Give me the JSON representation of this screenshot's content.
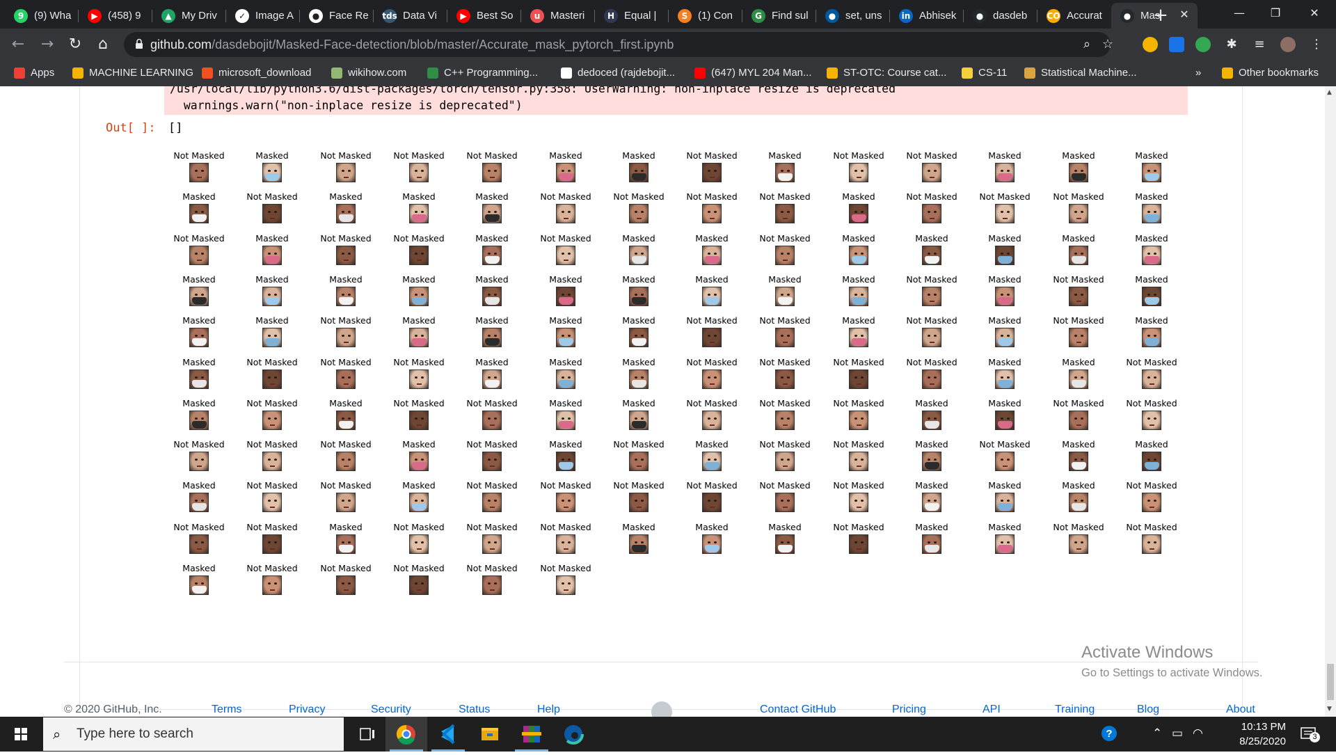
{
  "browser": {
    "tabs": [
      {
        "label": "(9) Wha",
        "icon": "whatsapp-icon",
        "color": "#25d366",
        "glyph": "9"
      },
      {
        "label": "(458) 9",
        "icon": "youtube-icon",
        "color": "#ff0000",
        "glyph": "▶"
      },
      {
        "label": "My Driv",
        "icon": "google-drive-icon",
        "color": "#1fa463",
        "glyph": "▲"
      },
      {
        "label": "Image A",
        "icon": "document-icon",
        "color": "#ffffff",
        "glyph": "✓"
      },
      {
        "label": "Face Re",
        "icon": "github-icon",
        "color": "#ffffff",
        "glyph": "●"
      },
      {
        "label": "Data Vi",
        "icon": "tds-icon",
        "color": "#355876",
        "glyph": "tds"
      },
      {
        "label": "Best So",
        "icon": "youtube-icon",
        "color": "#ff0000",
        "glyph": "▶"
      },
      {
        "label": "Masteri",
        "icon": "udemy-icon",
        "color": "#ec5252",
        "glyph": "u"
      },
      {
        "label": "Equal |",
        "icon": "hackerearth-icon",
        "color": "#323754",
        "glyph": "H"
      },
      {
        "label": "(1) Con",
        "icon": "stackoverflow-icon",
        "color": "#f48024",
        "glyph": "S"
      },
      {
        "label": "Find sul",
        "icon": "geeksforgeeks-icon",
        "color": "#2f8d46",
        "glyph": "G"
      },
      {
        "label": "set, uns",
        "icon": "cplusplus-icon",
        "color": "#00599c",
        "glyph": "●"
      },
      {
        "label": "Abhisek",
        "icon": "linkedin-icon",
        "color": "#0a66c2",
        "glyph": "in"
      },
      {
        "label": "dasdeb",
        "icon": "github-icon",
        "color": "#24292e",
        "glyph": "●"
      },
      {
        "label": "Accurat",
        "icon": "colab-icon",
        "color": "#f9ab00",
        "glyph": "CO"
      },
      {
        "label": "Mas",
        "icon": "github-icon",
        "color": "#24292e",
        "glyph": "●",
        "active": true
      }
    ],
    "new_tab_label": "+",
    "window_controls": {
      "minimize": "—",
      "restore": "❐",
      "close": "✕"
    },
    "url_domain": "github.com",
    "url_path": "/dasdebojit/Masked-Face-detection/blob/master/Accurate_mask_pytorch_first.ipynb",
    "bookmarks": [
      {
        "label": "Apps",
        "icon": "apps-grid-icon",
        "color": "#ea4335"
      },
      {
        "label": "MACHINE LEARNING",
        "icon": "folder-icon",
        "color": "#f4b400"
      },
      {
        "label": "microsoft_download",
        "icon": "microsoft-icon",
        "color": "#f25022"
      },
      {
        "label": "wikihow.com",
        "icon": "wikihow-icon",
        "color": "#93b874"
      },
      {
        "label": "C++ Programming...",
        "icon": "geeksforgeeks-icon",
        "color": "#2f8d46"
      },
      {
        "label": "dedoced (rajdebojit...",
        "icon": "github-icon",
        "color": "#ffffff"
      },
      {
        "label": "(647) MYL 204 Man...",
        "icon": "youtube-icon",
        "color": "#ff0000"
      },
      {
        "label": "ST-OTC: Course cat...",
        "icon": "iitm-icon",
        "color": "#f4b400"
      },
      {
        "label": "CS-11",
        "icon": "bookmark-icon",
        "color": "#f4d03f"
      },
      {
        "label": "Statistical Machine...",
        "icon": "stat-icon",
        "color": "#d9a441"
      }
    ],
    "bookmarks_overflow": "»",
    "other_bookmarks": "Other bookmarks"
  },
  "notebook": {
    "warning_line1": "/usr/local/lib/python3.6/dist-packages/torch/tensor.py:358: UserWarning: non-inplace resize is deprecated",
    "warning_line2": "  warnings.warn(\"non-inplace resize is deprecated\")",
    "out_prompt": "Out[ ]:",
    "out_value": "[]",
    "grid_rows": [
      [
        "Not Masked",
        "Masked",
        "Not Masked",
        "Not Masked",
        "Not Masked",
        "Masked",
        "Masked",
        "Not Masked",
        "Masked",
        "Not Masked",
        "Not Masked",
        "Masked",
        "Masked",
        "Masked"
      ],
      [
        "Masked",
        "Not Masked",
        "Masked",
        "Masked",
        "Masked",
        "Not Masked",
        "Not Masked",
        "Not Masked",
        "Not Masked",
        "Masked",
        "Not Masked",
        "Not Masked",
        "Not Masked",
        "Masked"
      ],
      [
        "Not Masked",
        "Masked",
        "Not Masked",
        "Not Masked",
        "Masked",
        "Not Masked",
        "Masked",
        "Masked",
        "Not Masked",
        "Masked",
        "Masked",
        "Masked",
        "Masked",
        "Masked"
      ],
      [
        "Masked",
        "Masked",
        "Masked",
        "Masked",
        "Masked",
        "Masked",
        "Masked",
        "Masked",
        "Masked",
        "Masked",
        "Not Masked",
        "Masked",
        "Not Masked",
        "Masked"
      ],
      [
        "Masked",
        "Masked",
        "Not Masked",
        "Masked",
        "Masked",
        "Masked",
        "Masked",
        "Not Masked",
        "Not Masked",
        "Masked",
        "Not Masked",
        "Masked",
        "Not Masked",
        "Masked"
      ],
      [
        "Masked",
        "Not Masked",
        "Not Masked",
        "Not Masked",
        "Masked",
        "Masked",
        "Masked",
        "Not Masked",
        "Not Masked",
        "Not Masked",
        "Not Masked",
        "Masked",
        "Masked",
        "Not Masked"
      ],
      [
        "Masked",
        "Not Masked",
        "Masked",
        "Not Masked",
        "Not Masked",
        "Masked",
        "Masked",
        "Not Masked",
        "Not Masked",
        "Not Masked",
        "Masked",
        "Masked",
        "Not Masked",
        "Not Masked"
      ],
      [
        "Not Masked",
        "Not Masked",
        "Not Masked",
        "Masked",
        "Not Masked",
        "Masked",
        "Not Masked",
        "Masked",
        "Not Masked",
        "Not Masked",
        "Masked",
        "Not Masked",
        "Masked",
        "Masked"
      ],
      [
        "Masked",
        "Not Masked",
        "Not Masked",
        "Masked",
        "Not Masked",
        "Not Masked",
        "Not Masked",
        "Not Masked",
        "Not Masked",
        "Not Masked",
        "Masked",
        "Masked",
        "Masked",
        "Not Masked"
      ],
      [
        "Not Masked",
        "Not Masked",
        "Masked",
        "Not Masked",
        "Not Masked",
        "Not Masked",
        "Masked",
        "Masked",
        "Masked",
        "Not Masked",
        "Masked",
        "Masked",
        "Not Masked",
        "Not Masked"
      ],
      [
        "Masked",
        "Not Masked",
        "Not Masked",
        "Not Masked",
        "Not Masked",
        "Not Masked"
      ]
    ]
  },
  "footer": {
    "copyright": "© 2020 GitHub, Inc.",
    "links_left": [
      "Terms",
      "Privacy",
      "Security",
      "Status",
      "Help"
    ],
    "links_right": [
      "Contact GitHub",
      "Pricing",
      "API",
      "Training",
      "Blog",
      "About"
    ]
  },
  "watermark": {
    "title": "Activate Windows",
    "subtitle": "Go to Settings to activate Windows."
  },
  "taskbar": {
    "search_placeholder": "Type here to search",
    "time": "10:13 PM",
    "date": "8/25/2020",
    "notification_count": "3"
  }
}
